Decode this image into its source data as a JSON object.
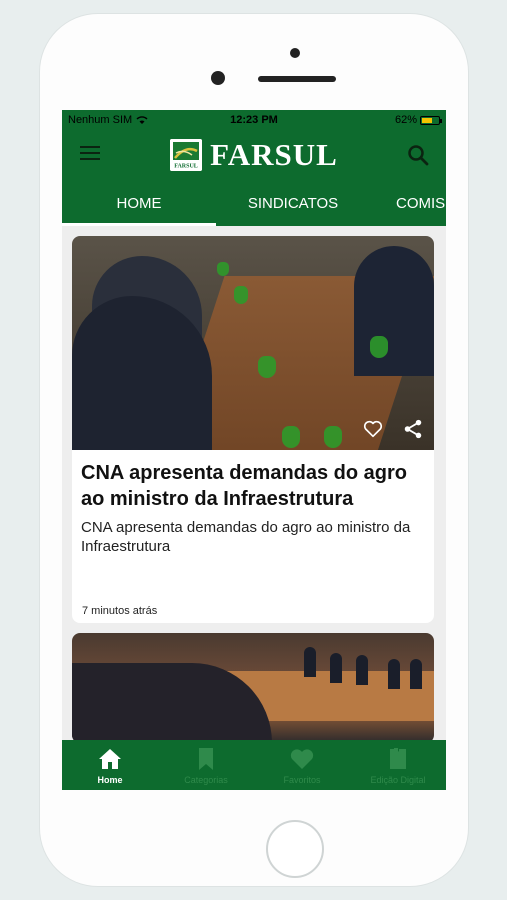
{
  "status": {
    "carrier": "Nenhum SIM",
    "time": "12:23 PM",
    "battery": "62%",
    "battery_level": 0.62
  },
  "header": {
    "brand": "FARSUL",
    "logo_badge": "FARSUL"
  },
  "tabs": [
    {
      "label": "HOME",
      "active": true
    },
    {
      "label": "SINDICATOS",
      "active": false
    },
    {
      "label": "COMIS",
      "active": false
    }
  ],
  "articles": [
    {
      "title": "CNA apresenta demandas do agro ao ministro da Infraestrutura",
      "summary": "CNA apresenta demandas do agro ao ministro da Infraestrutura",
      "time": "7 minutos atrás"
    }
  ],
  "bottom_nav": [
    {
      "label": "Home",
      "icon": "home-icon",
      "active": true
    },
    {
      "label": "Categorias",
      "icon": "bookmark-icon",
      "active": false
    },
    {
      "label": "Favoritos",
      "icon": "heart-icon",
      "active": false
    },
    {
      "label": "Edição Digital",
      "icon": "book-icon",
      "active": false
    }
  ],
  "colors": {
    "brand_green": "#0d6b2e",
    "inactive_nav": "#2f8a4b",
    "background": "#eeeeee"
  }
}
